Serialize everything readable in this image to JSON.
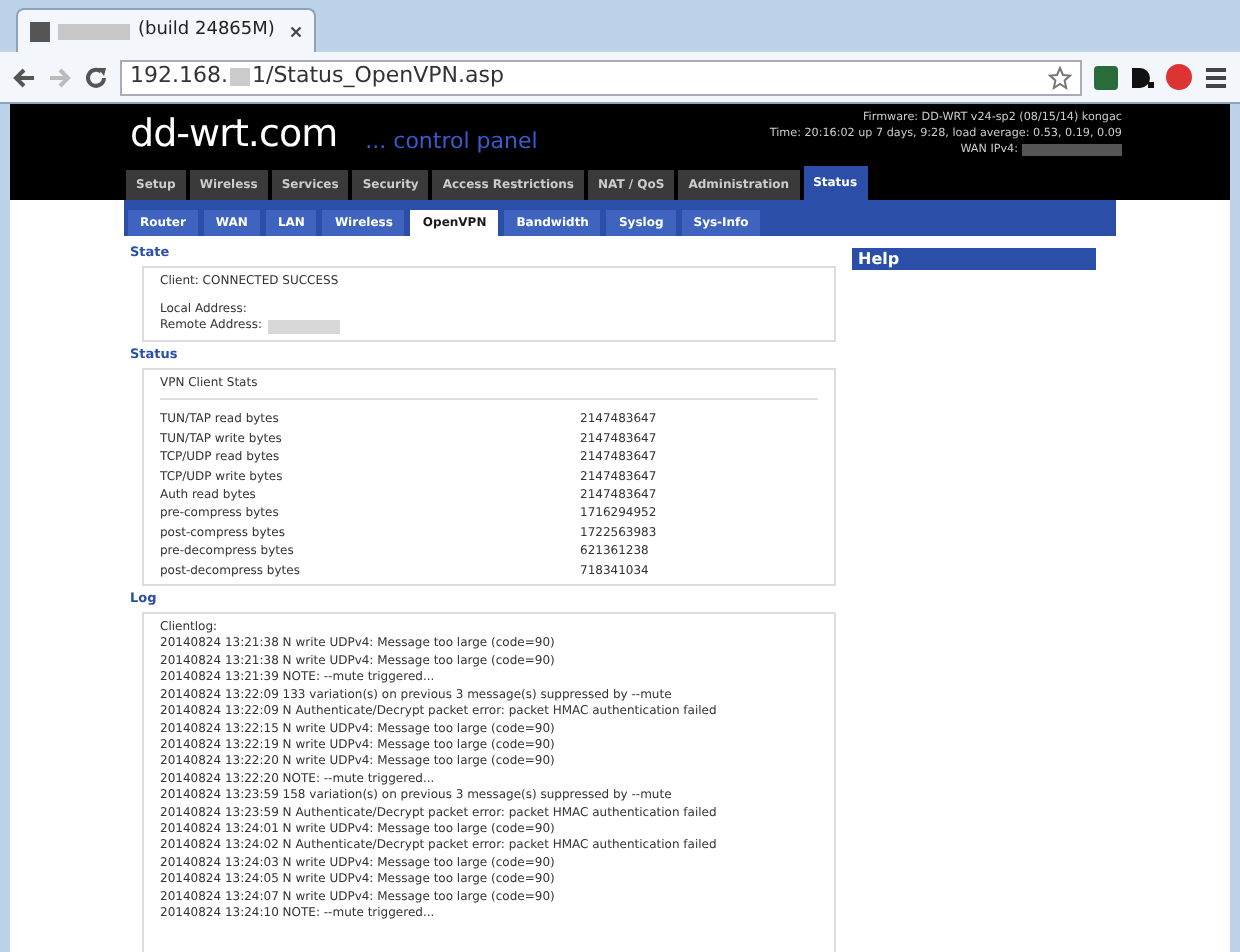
{
  "browser": {
    "tab_title": "(build 24865M)",
    "url_parts": [
      "192.168.",
      "1/Status_OpenVPN.asp"
    ]
  },
  "header": {
    "logo": "dd-wrt.com",
    "subtitle": "... control panel",
    "firmware": "Firmware: DD-WRT v24-sp2 (08/15/14) kongac",
    "time": "Time: 20:16:02 up 7 days, 9:28, load average: 0.53, 0.19, 0.09",
    "wan": "WAN IPv4:"
  },
  "main_tabs": [
    {
      "label": "Setup",
      "selected": false
    },
    {
      "label": "Wireless",
      "selected": false
    },
    {
      "label": "Services",
      "selected": false
    },
    {
      "label": "Security",
      "selected": false
    },
    {
      "label": "Access Restrictions",
      "selected": false
    },
    {
      "label": "NAT / QoS",
      "selected": false
    },
    {
      "label": "Administration",
      "selected": false
    },
    {
      "label": "Status",
      "selected": true
    }
  ],
  "sub_tabs": [
    {
      "label": "Router",
      "selected": false
    },
    {
      "label": "WAN",
      "selected": false
    },
    {
      "label": "LAN",
      "selected": false
    },
    {
      "label": "Wireless",
      "selected": false
    },
    {
      "label": "OpenVPN",
      "selected": true
    },
    {
      "label": "Bandwidth",
      "selected": false
    },
    {
      "label": "Syslog",
      "selected": false
    },
    {
      "label": "Sys-Info",
      "selected": false
    }
  ],
  "state": {
    "title": "State",
    "client": "Client: CONNECTED SUCCESS",
    "local_address": "Local Address:",
    "remote_address": "Remote Address:"
  },
  "status": {
    "title": "Status",
    "heading": "VPN Client Stats",
    "rows": [
      {
        "label": "TUN/TAP read bytes",
        "value": "2147483647"
      },
      {
        "label": "TUN/TAP write bytes",
        "value": "2147483647"
      },
      {
        "label": "TCP/UDP read bytes",
        "value": "2147483647"
      },
      {
        "label": "TCP/UDP write bytes",
        "value": "2147483647"
      },
      {
        "label": "Auth read bytes",
        "value": "2147483647"
      },
      {
        "label": "pre-compress bytes",
        "value": "1716294952"
      },
      {
        "label": "post-compress bytes",
        "value": "1722563983"
      },
      {
        "label": "pre-decompress bytes",
        "value": "621361238"
      },
      {
        "label": "post-decompress bytes",
        "value": "718341034"
      }
    ]
  },
  "log": {
    "title": "Log",
    "lines": [
      "Clientlog:",
      "20140824 13:21:38 N write UDPv4: Message too large (code=90)",
      "20140824 13:21:38 N write UDPv4: Message too large (code=90)",
      "20140824 13:21:39 NOTE: --mute triggered...",
      "20140824 13:22:09 133 variation(s) on previous 3 message(s) suppressed by --mute",
      "20140824 13:22:09 N Authenticate/Decrypt packet error: packet HMAC authentication failed",
      "20140824 13:22:15 N write UDPv4: Message too large (code=90)",
      "20140824 13:22:19 N write UDPv4: Message too large (code=90)",
      "20140824 13:22:20 N write UDPv4: Message too large (code=90)",
      "20140824 13:22:20 NOTE: --mute triggered...",
      "20140824 13:23:59 158 variation(s) on previous 3 message(s) suppressed by --mute",
      "20140824 13:23:59 N Authenticate/Decrypt packet error: packet HMAC authentication failed",
      "20140824 13:24:01 N write UDPv4: Message too large (code=90)",
      "20140824 13:24:02 N Authenticate/Decrypt packet error: packet HMAC authentication failed",
      "20140824 13:24:03 N write UDPv4: Message too large (code=90)",
      "20140824 13:24:05 N write UDPv4: Message too large (code=90)",
      "20140824 13:24:07 N write UDPv4: Message too large (code=90)",
      "20140824 13:24:10 NOTE: --mute triggered..."
    ]
  },
  "help": {
    "title": "Help"
  }
}
